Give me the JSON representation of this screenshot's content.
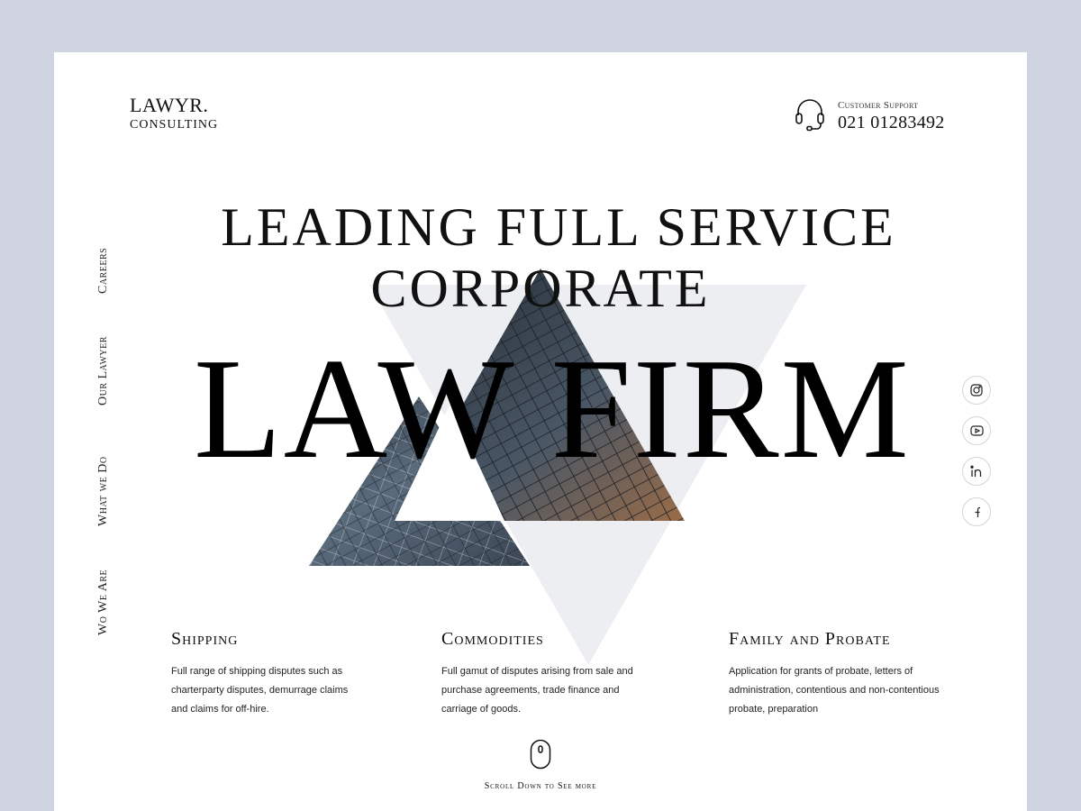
{
  "brand": {
    "name": "LAWYR.",
    "tagline": "CONSULTING"
  },
  "support": {
    "label": "Customer Support",
    "phone": "021 01283492",
    "icon": "headset-icon"
  },
  "side_nav": [
    {
      "label": "Careers"
    },
    {
      "label": "Our Lawyer"
    },
    {
      "label": "What we Do"
    },
    {
      "label": "Wo We Are"
    }
  ],
  "hero": {
    "line1": "LEADING FULL SERVICE",
    "line2": "CORPORATE",
    "big": "LAW FIRM"
  },
  "social": [
    {
      "name": "instagram-icon"
    },
    {
      "name": "youtube-icon"
    },
    {
      "name": "linkedin-icon"
    },
    {
      "name": "facebook-icon"
    }
  ],
  "services": [
    {
      "title": "Shipping",
      "desc_lines": [
        "Full range of shipping disputes such as",
        "charterparty disputes, demurrage claims",
        "and claims for off-hire."
      ]
    },
    {
      "title": "Commodities",
      "desc_lines": [
        "Full gamut of disputes arising from sale and",
        "purchase agreements, trade finance and",
        "carriage of goods."
      ]
    },
    {
      "title": "Family and Probate",
      "desc_lines": [
        "Application for grants of probate, letters of",
        "administration, contentious and non-contentious",
        "probate, preparation"
      ]
    }
  ],
  "scroll": {
    "label": "Scroll Down to See more",
    "icon": "mouse-icon"
  },
  "colors": {
    "background": "#cfd4e0",
    "page": "#ffffff",
    "text": "#111111",
    "triangle_light": "#eceef1"
  }
}
